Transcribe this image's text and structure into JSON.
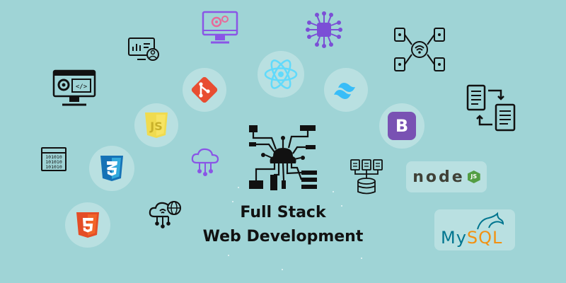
{
  "headline": {
    "line1": "Full Stack",
    "line2": "Web Development"
  },
  "logos": {
    "bootstrap_letter": "B",
    "node_wordmark": "node",
    "node_badge": "JS",
    "mysql_wordmark_my": "My",
    "mysql_wordmark_sql": "SQL",
    "binary_rows": [
      "101010",
      "101010",
      "101010"
    ]
  },
  "colors": {
    "background": "#9fd4d6",
    "html5": "#e44d26",
    "css3": "#1572b6",
    "js": "#f0db4f",
    "git": "#e84d31",
    "react": "#61dafb",
    "tailwind": "#38bdf8",
    "bootstrap": "#7952b3",
    "node": "#539e43",
    "mysql_blue": "#00758f",
    "mysql_orange": "#f29111",
    "purple_icon": "#8a55e6",
    "outline": "#111111"
  },
  "icons": [
    "settings-monitor-icon",
    "circuit-chip-icon",
    "analytics-monitor-icon",
    "code-monitor-icon",
    "git-icon",
    "react-icon",
    "tailwind-icon",
    "network-devices-icon",
    "document-sync-icon",
    "js-icon",
    "bootstrap-icon",
    "binary-window-icon",
    "css3-icon",
    "cloud-network-icon",
    "database-files-icon",
    "node-icon",
    "html5-icon",
    "cloud-globe-icon",
    "mysql-icon",
    "circuit-brain-icon"
  ]
}
